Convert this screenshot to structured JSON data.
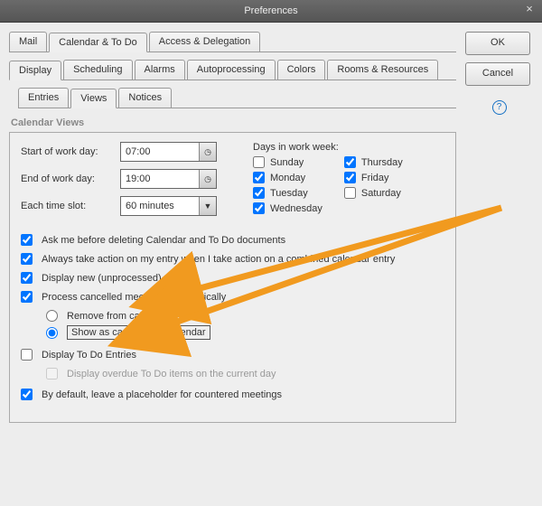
{
  "window": {
    "title": "Preferences"
  },
  "buttons": {
    "ok": "OK",
    "cancel": "Cancel"
  },
  "mainTabs": [
    "Mail",
    "Calendar & To Do",
    "Access & Delegation"
  ],
  "subTabs": [
    "Display",
    "Scheduling",
    "Alarms",
    "Autoprocessing",
    "Colors",
    "Rooms & Resources"
  ],
  "innerTabs": [
    "Entries",
    "Views",
    "Notices"
  ],
  "section": "Calendar Views",
  "labels": {
    "start": "Start of work day:",
    "end": "End of work day:",
    "slot": "Each time slot:",
    "daysTitle": "Days in work week:"
  },
  "values": {
    "start": "07:00",
    "end": "19:00",
    "slot": "60 minutes"
  },
  "days": {
    "sunday": {
      "label": "Sunday",
      "checked": false
    },
    "monday": {
      "label": "Monday",
      "checked": true
    },
    "tuesday": {
      "label": "Tuesday",
      "checked": true
    },
    "wednesday": {
      "label": "Wednesday",
      "checked": true
    },
    "thursday": {
      "label": "Thursday",
      "checked": true
    },
    "friday": {
      "label": "Friday",
      "checked": true
    },
    "saturday": {
      "label": "Saturday",
      "checked": false
    }
  },
  "opts": {
    "askDelete": "Ask me before deleting Calendar and To Do documents",
    "alwaysTake": "Always take action on my entry when I take action on a combined calendar entry",
    "displayNew": "Display new (unprocessed) notices",
    "processCancelled": "Process cancelled meetings automatically",
    "removeFrom": "Remove from calendar",
    "showCancelled": "Show as cancelled in calendar",
    "displayTodo": "Display To Do Entries",
    "displayOverdue": "Display overdue To Do items on the current day",
    "placeholder": "By default, leave a placeholder for countered meetings"
  }
}
